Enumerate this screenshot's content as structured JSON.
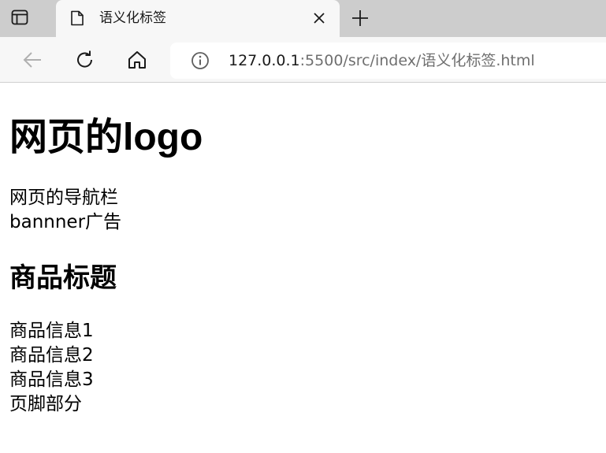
{
  "browser": {
    "tab": {
      "title": "语义化标签"
    },
    "address": {
      "host": "127.0.0.1",
      "rest": ":5500/src/index/语义化标签.html"
    }
  },
  "page": {
    "logo": "网页的logo",
    "nav": "网页的导航栏",
    "banner": "bannner广告",
    "product_title": "商品标题",
    "items": [
      "商品信息1",
      "商品信息2",
      "商品信息3"
    ],
    "footer": "页脚部分"
  }
}
